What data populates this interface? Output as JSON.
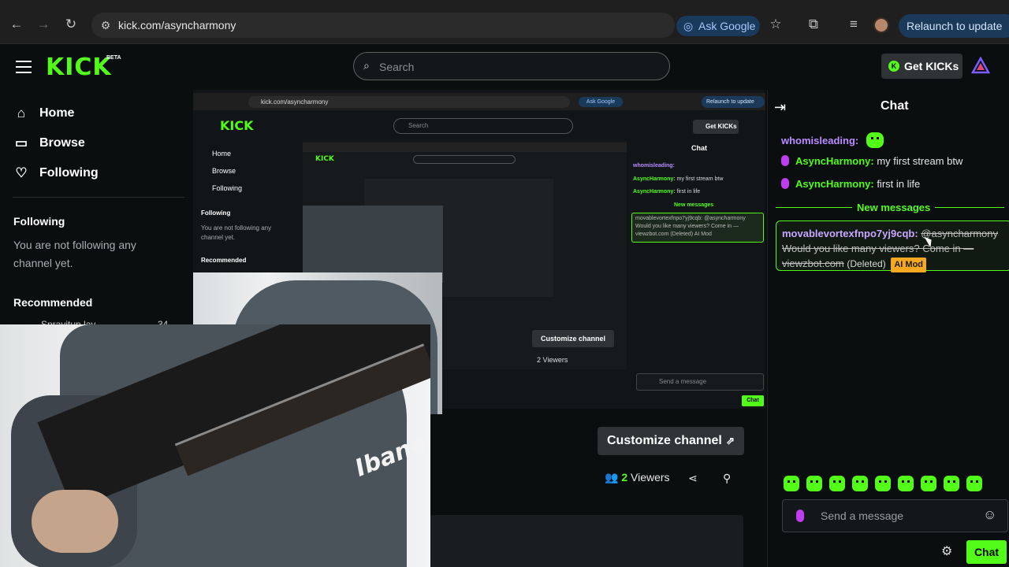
{
  "browser": {
    "url": "kick.com/asyncharmony",
    "ask_google": "Ask Google",
    "relaunch": "Relaunch to update"
  },
  "topnav": {
    "logo": "KICK",
    "beta": "BETA",
    "search_placeholder": "Search",
    "get_kicks": "Get KICKs"
  },
  "sidebar": {
    "items": [
      {
        "label": "Home",
        "icon": "home-icon"
      },
      {
        "label": "Browse",
        "icon": "browse-icon"
      },
      {
        "label": "Following",
        "icon": "heart-icon"
      }
    ],
    "following_heading": "Following",
    "following_empty": "You are not following any channel yet.",
    "recommended_heading": "Recommended",
    "recommended_name": "Spravitup lay",
    "recommended_count": "34"
  },
  "nested": {
    "url": "kick.com/asyncharmony",
    "ask": "Ask Google",
    "relaunch": "Relaunch to update",
    "logo": "KICK",
    "search": "Search",
    "get_kicks": "Get KICKs",
    "nav": [
      "Home",
      "Browse",
      "Following"
    ],
    "following": "Following",
    "following_empty": "You are not following any channel yet.",
    "recommended": "Recommended",
    "chat_title": "Chat",
    "msg1_user": "whomisleading:",
    "msg2_user": "AsyncHarmony:",
    "msg2_text": "my first stream btw",
    "msg3_user": "AsyncHarmony:",
    "msg3_text": "first in life",
    "new_messages": "New messages",
    "deleted_line": "movablevortexfnpo7yj9cqb: @asyncharmony Would you like many viewers? Come in — viewzbot.com (Deleted) AI Mod",
    "customize": "Customize channel",
    "viewers": "2 Viewers",
    "send_placeholder": "Send a message",
    "chat_button": "Chat"
  },
  "channel": {
    "customize_label": "Customize channel",
    "viewer_count": "2",
    "viewer_label": "Viewers"
  },
  "chat": {
    "title": "Chat",
    "messages": [
      {
        "user": "whomisleading:",
        "text": ""
      },
      {
        "user": "AsyncHarmony:",
        "text": " my first stream btw"
      },
      {
        "user": "AsyncHarmony:",
        "text": " first in life"
      }
    ],
    "new_messages": "New messages",
    "deleted": {
      "user": "movablevortexfnpo7yj9cqb:",
      "mention": "@asyncharmony",
      "line2": "Would you like many viewers? Come in —",
      "line3": "viewzbot.com",
      "deleted_label": "(Deleted)",
      "badge": "AI Mod"
    },
    "send_placeholder": "Send a message",
    "chat_button": "Chat"
  },
  "video": {
    "guitar_brand": "Ibanez"
  },
  "colors": {
    "accent": "#53fc18",
    "username_purple": "#b98cff",
    "ai_mod": "#f7a823"
  }
}
